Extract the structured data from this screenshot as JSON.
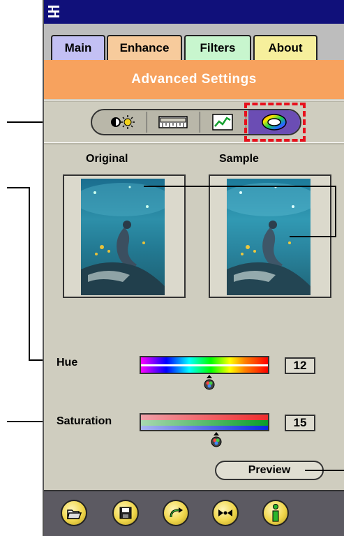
{
  "tabs": [
    {
      "label": "Main",
      "color": "#c3c0f4"
    },
    {
      "label": "Enhance",
      "color": "#f7cb9c"
    },
    {
      "label": "Filters",
      "color": "#c8f6ce"
    },
    {
      "label": "About",
      "color": "#f6ef9c"
    }
  ],
  "active_tab": "Enhance",
  "banner_title": "Advanced Settings",
  "mode_buttons": [
    {
      "icon": "brightness-icon"
    },
    {
      "icon": "ruler-icon"
    },
    {
      "icon": "curve-graph-icon"
    },
    {
      "icon": "color-wheel-icon",
      "selected": true
    }
  ],
  "images": {
    "original_label": "Original",
    "sample_label": "Sample"
  },
  "hue": {
    "label": "Hue",
    "value": "12"
  },
  "saturation": {
    "label": "Saturation",
    "value": "15"
  },
  "preview_label": "Preview",
  "toolbar_buttons": [
    "open-folder-icon",
    "save-disk-icon",
    "undo-arrow-icon",
    "compare-icon",
    "info-icon"
  ],
  "colors": {
    "titlebar": "#10107a",
    "banner": "#f7a25e",
    "panel": "#cfcdbf",
    "selection_dash": "#e8101c",
    "toolbar": "#5c5a62"
  }
}
